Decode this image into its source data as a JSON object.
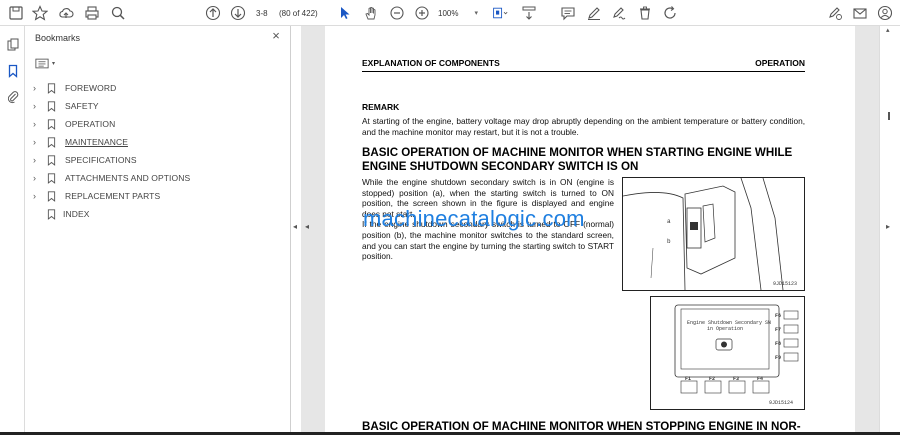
{
  "toolbar": {
    "current_page": "3-8",
    "page_count": "(80 of 422)",
    "zoom": "100%"
  },
  "bookmarks": {
    "title": "Bookmarks",
    "close": "×",
    "items": [
      {
        "label": "FOREWORD",
        "expandable": true
      },
      {
        "label": "SAFETY",
        "expandable": true
      },
      {
        "label": "OPERATION",
        "expandable": true
      },
      {
        "label": "MAINTENANCE",
        "expandable": true
      },
      {
        "label": "SPECIFICATIONS",
        "expandable": true
      },
      {
        "label": "ATTACHMENTS AND OPTIONS",
        "expandable": true
      },
      {
        "label": "REPLACEMENT PARTS",
        "expandable": true
      },
      {
        "label": "INDEX",
        "expandable": false
      }
    ]
  },
  "document": {
    "header_left": "EXPLANATION OF COMPONENTS",
    "header_right": "OPERATION",
    "remark_title": "REMARK",
    "remark_text": "At starting of the engine, battery voltage may drop abruptly depending on the ambient temperature or battery condition, and the machine monitor may restart, but it is not a trouble.",
    "heading1": "BASIC OPERATION OF MACHINE MONITOR WHEN STARTING ENGINE WHILE ENGINE SHUTDOWN SECONDARY SWITCH IS ON",
    "para_a": "While the engine shutdown secondary switch is in ON (engine is stopped) position (a), when the starting switch is turned to ON position, the screen shown in the figure is displayed and engine does not start.",
    "para_b": "If the engine shutdown secondary switch is turned to OFF (normal) position (b), the machine monitor switches to the standard screen, and you can start the engine by turning the starting switch to START position.",
    "heading2": "BASIC OPERATION OF MACHINE MONITOR WHEN STOPPING ENGINE IN NOR-",
    "fig1_code": "9JD15123",
    "fig1_a": "a",
    "fig1_b": "b",
    "fig2_code": "9JD15124",
    "fig2_screen_line1": "Engine Shutdown Secondary SW",
    "fig2_screen_line2": "in Operation",
    "fig2_keys_right": [
      "F6",
      "F7",
      "F8",
      "F9"
    ],
    "fig2_keys_bottom": [
      "F1",
      "F2",
      "F3",
      "F4"
    ]
  },
  "watermark": "machinecatalogic.com"
}
